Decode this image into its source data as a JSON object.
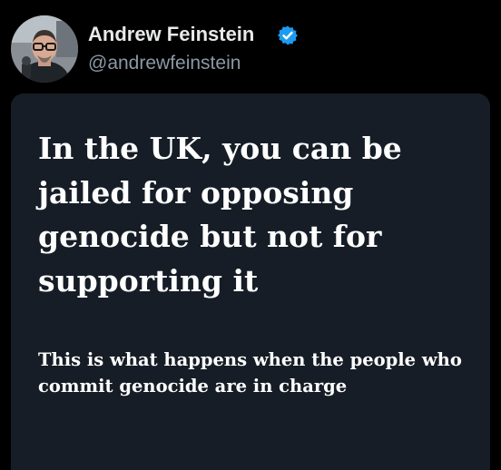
{
  "tweet": {
    "author": {
      "display_name": "Andrew Feinstein",
      "handle": "@andrewfeinstein",
      "verified": true,
      "avatar_icon": "avatar-photo"
    },
    "card": {
      "headline": "In the UK, you can be jailed for opposing genocide but not for supporting it",
      "subline": "This is what happens when the people who commit genocide are in charge"
    }
  },
  "colors": {
    "background": "#000000",
    "card_background": "#161d26",
    "name_text": "#e7e9ea",
    "handle_text": "#8b98a5",
    "verified_badge": "#1d9bf0"
  }
}
